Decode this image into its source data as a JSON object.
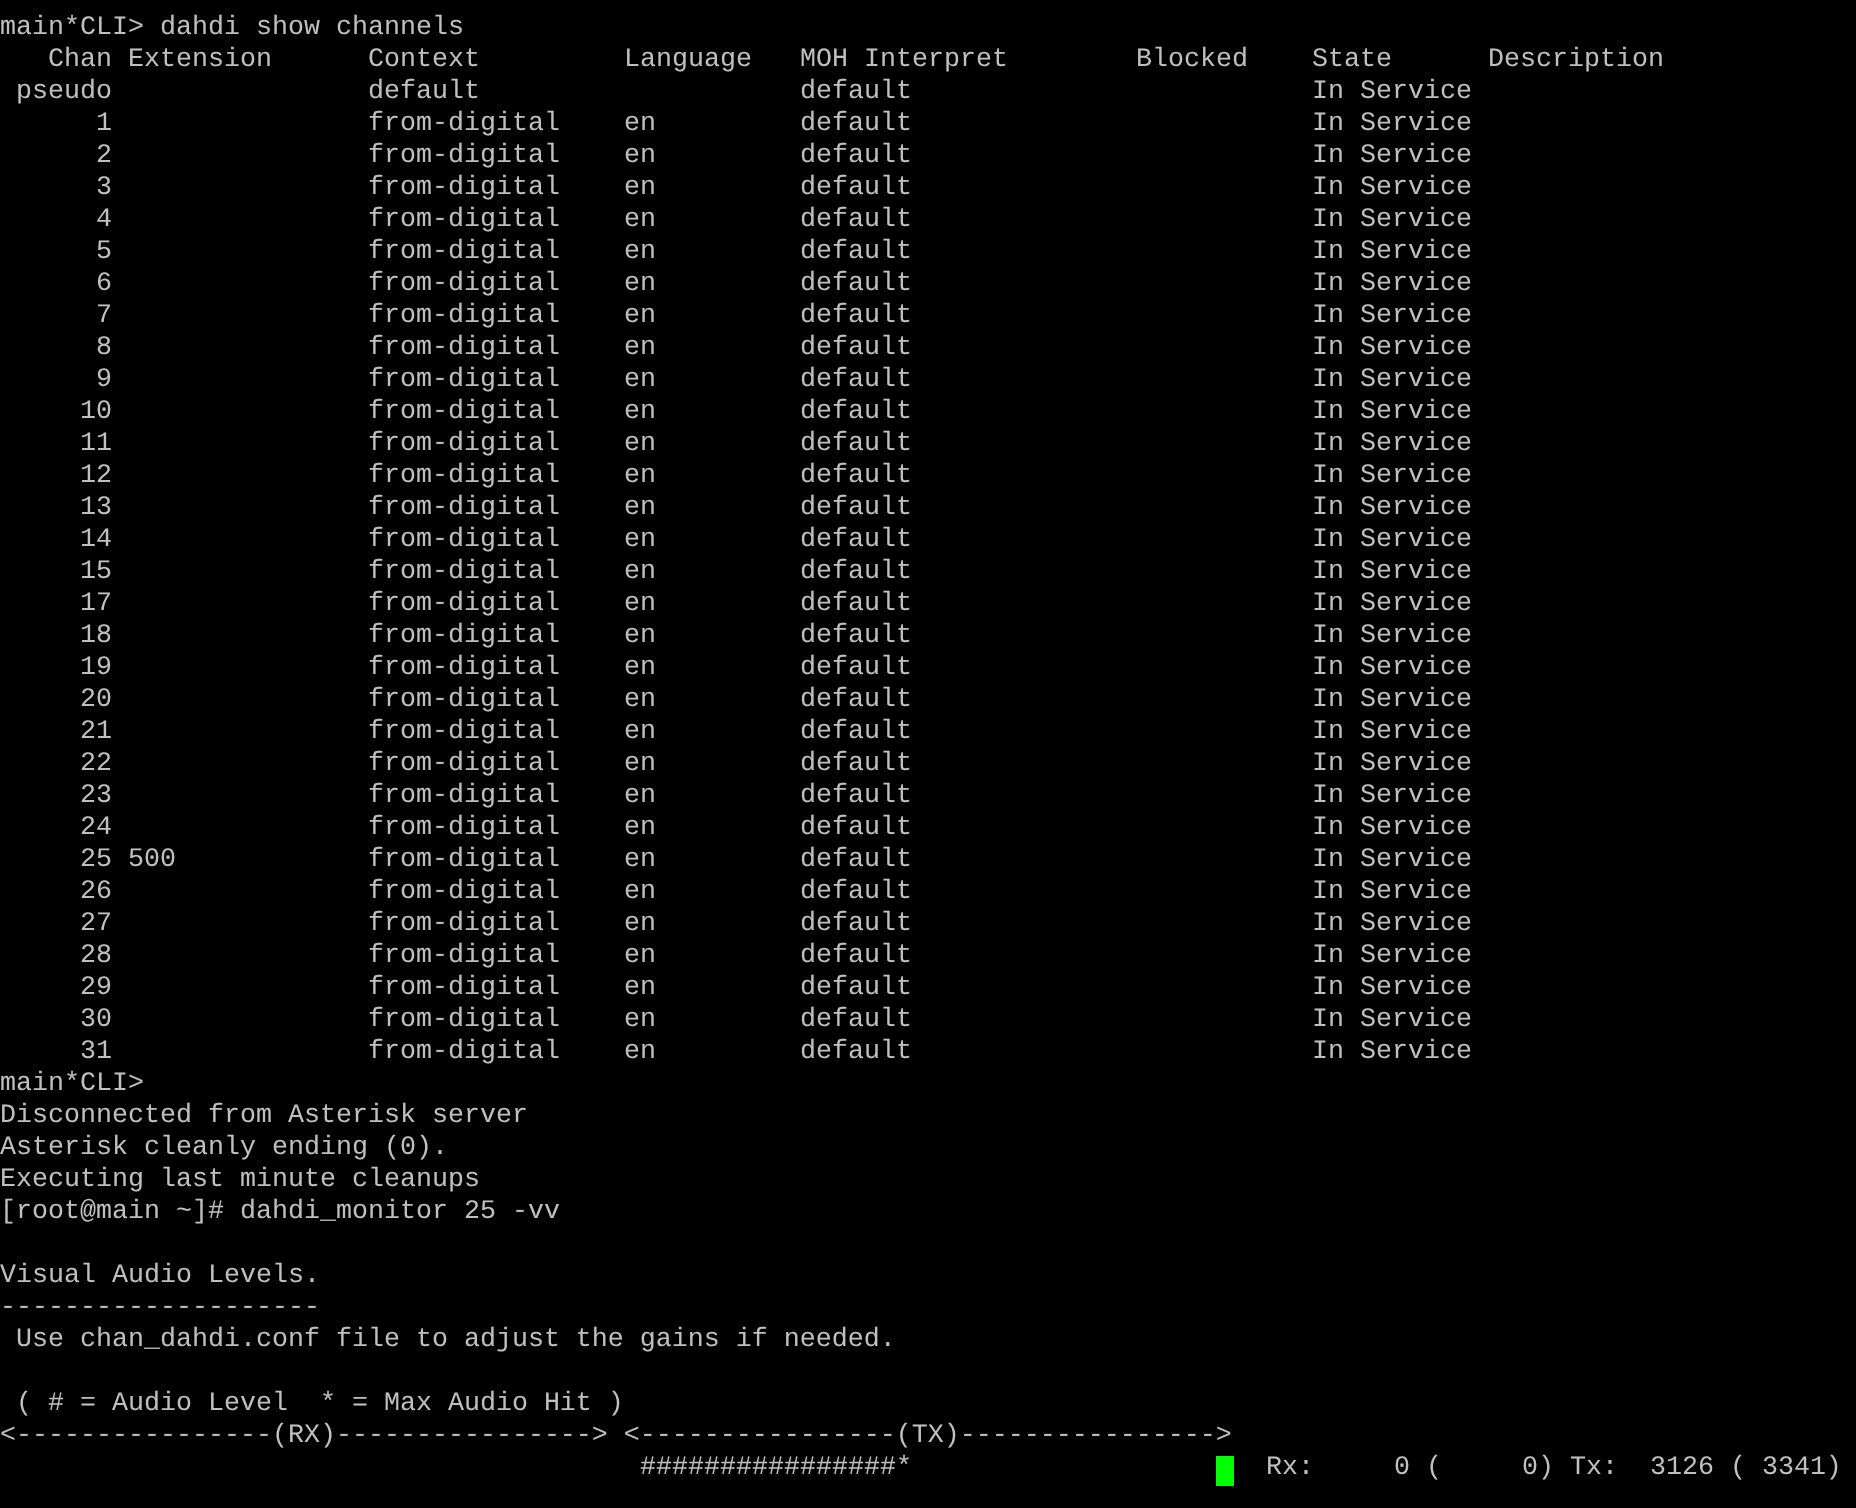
{
  "terminal": {
    "lines_before": [
      {
        "kind": "text",
        "text": "main*CLI> dahdi show channels"
      }
    ],
    "table": {
      "columns": [
        "Chan",
        "Extension",
        "Context",
        "Language",
        "MOH Interpret",
        "Blocked",
        "State",
        "Description"
      ],
      "rows": [
        {
          "chan": "pseudo",
          "context": "default",
          "moh": "default",
          "state": "In Service"
        },
        {
          "chan": "1",
          "context": "from-digital",
          "language": "en",
          "moh": "default",
          "state": "In Service"
        },
        {
          "chan": "2",
          "context": "from-digital",
          "language": "en",
          "moh": "default",
          "state": "In Service"
        },
        {
          "chan": "3",
          "context": "from-digital",
          "language": "en",
          "moh": "default",
          "state": "In Service"
        },
        {
          "chan": "4",
          "context": "from-digital",
          "language": "en",
          "moh": "default",
          "state": "In Service"
        },
        {
          "chan": "5",
          "context": "from-digital",
          "language": "en",
          "moh": "default",
          "state": "In Service"
        },
        {
          "chan": "6",
          "context": "from-digital",
          "language": "en",
          "moh": "default",
          "state": "In Service"
        },
        {
          "chan": "7",
          "context": "from-digital",
          "language": "en",
          "moh": "default",
          "state": "In Service"
        },
        {
          "chan": "8",
          "context": "from-digital",
          "language": "en",
          "moh": "default",
          "state": "In Service"
        },
        {
          "chan": "9",
          "context": "from-digital",
          "language": "en",
          "moh": "default",
          "state": "In Service"
        },
        {
          "chan": "10",
          "context": "from-digital",
          "language": "en",
          "moh": "default",
          "state": "In Service"
        },
        {
          "chan": "11",
          "context": "from-digital",
          "language": "en",
          "moh": "default",
          "state": "In Service"
        },
        {
          "chan": "12",
          "context": "from-digital",
          "language": "en",
          "moh": "default",
          "state": "In Service"
        },
        {
          "chan": "13",
          "context": "from-digital",
          "language": "en",
          "moh": "default",
          "state": "In Service"
        },
        {
          "chan": "14",
          "context": "from-digital",
          "language": "en",
          "moh": "default",
          "state": "In Service"
        },
        {
          "chan": "15",
          "context": "from-digital",
          "language": "en",
          "moh": "default",
          "state": "In Service"
        },
        {
          "chan": "17",
          "context": "from-digital",
          "language": "en",
          "moh": "default",
          "state": "In Service"
        },
        {
          "chan": "18",
          "context": "from-digital",
          "language": "en",
          "moh": "default",
          "state": "In Service"
        },
        {
          "chan": "19",
          "context": "from-digital",
          "language": "en",
          "moh": "default",
          "state": "In Service"
        },
        {
          "chan": "20",
          "context": "from-digital",
          "language": "en",
          "moh": "default",
          "state": "In Service"
        },
        {
          "chan": "21",
          "context": "from-digital",
          "language": "en",
          "moh": "default",
          "state": "In Service"
        },
        {
          "chan": "22",
          "context": "from-digital",
          "language": "en",
          "moh": "default",
          "state": "In Service"
        },
        {
          "chan": "23",
          "context": "from-digital",
          "language": "en",
          "moh": "default",
          "state": "In Service"
        },
        {
          "chan": "24",
          "context": "from-digital",
          "language": "en",
          "moh": "default",
          "state": "In Service"
        },
        {
          "chan": "25",
          "extension": "500",
          "context": "from-digital",
          "language": "en",
          "moh": "default",
          "state": "In Service"
        },
        {
          "chan": "26",
          "context": "from-digital",
          "language": "en",
          "moh": "default",
          "state": "In Service"
        },
        {
          "chan": "27",
          "context": "from-digital",
          "language": "en",
          "moh": "default",
          "state": "In Service"
        },
        {
          "chan": "28",
          "context": "from-digital",
          "language": "en",
          "moh": "default",
          "state": "In Service"
        },
        {
          "chan": "29",
          "context": "from-digital",
          "language": "en",
          "moh": "default",
          "state": "In Service"
        },
        {
          "chan": "30",
          "context": "from-digital",
          "language": "en",
          "moh": "default",
          "state": "In Service"
        },
        {
          "chan": "31",
          "context": "from-digital",
          "language": "en",
          "moh": "default",
          "state": "In Service"
        }
      ]
    },
    "lines_after": [
      {
        "kind": "text",
        "text": "main*CLI>"
      },
      {
        "kind": "text",
        "text": "Disconnected from Asterisk server"
      },
      {
        "kind": "text",
        "text": "Asterisk cleanly ending (0)."
      },
      {
        "kind": "text",
        "text": "Executing last minute cleanups"
      },
      {
        "kind": "text",
        "text": "[root@main ~]# dahdi_monitor 25 -vv"
      },
      {
        "kind": "blank"
      },
      {
        "kind": "text",
        "text": "Visual Audio Levels."
      },
      {
        "kind": "text",
        "text": "--------------------"
      },
      {
        "kind": "text",
        "text": " Use chan_dahdi.conf file to adjust the gains if needed."
      },
      {
        "kind": "blank"
      },
      {
        "kind": "text",
        "text": " ( # = Audio Level  * = Max Audio Hit )"
      },
      {
        "kind": "text",
        "text": "<----------------(RX)----------------> <----------------(TX)---------------->"
      }
    ],
    "meter_line": {
      "tx_meter": "################*",
      "counters": "Rx:     0 (     0) Tx:  3126 ( 3341)"
    }
  }
}
